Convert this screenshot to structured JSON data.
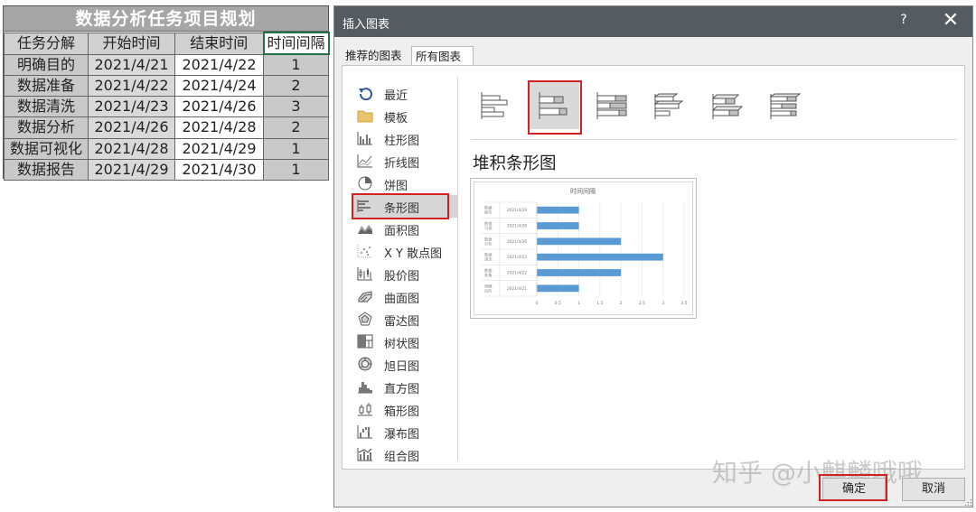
{
  "sheet": {
    "title": "数据分析任务项目规划",
    "headers": [
      "任务分解",
      "开始时间",
      "结束时间",
      "时间间隔"
    ],
    "rows": [
      [
        "明确目的",
        "2021/4/21",
        "2021/4/22",
        "1"
      ],
      [
        "数据准备",
        "2021/4/22",
        "2021/4/24",
        "2"
      ],
      [
        "数据清洗",
        "2021/4/23",
        "2021/4/26",
        "3"
      ],
      [
        "数据分析",
        "2021/4/26",
        "2021/4/28",
        "2"
      ],
      [
        "数据可视化",
        "2021/4/28",
        "2021/4/29",
        "1"
      ],
      [
        "数据报告",
        "2021/4/29",
        "2021/4/30",
        "1"
      ]
    ]
  },
  "dialog": {
    "title": "插入图表",
    "help": "?",
    "close": "✕",
    "tabs": [
      "推荐的图表",
      "所有图表"
    ],
    "chart_types": [
      {
        "label": "最近",
        "icon": "recent-icon"
      },
      {
        "label": "模板",
        "icon": "folder-icon"
      },
      {
        "label": "柱形图",
        "icon": "column-chart-icon"
      },
      {
        "label": "折线图",
        "icon": "line-chart-icon"
      },
      {
        "label": "饼图",
        "icon": "pie-chart-icon"
      },
      {
        "label": "条形图",
        "icon": "bar-chart-icon"
      },
      {
        "label": "面积图",
        "icon": "area-chart-icon"
      },
      {
        "label": "X Y 散点图",
        "icon": "scatter-chart-icon"
      },
      {
        "label": "股价图",
        "icon": "stock-chart-icon"
      },
      {
        "label": "曲面图",
        "icon": "surface-chart-icon"
      },
      {
        "label": "雷达图",
        "icon": "radar-chart-icon"
      },
      {
        "label": "树状图",
        "icon": "treemap-chart-icon"
      },
      {
        "label": "旭日图",
        "icon": "sunburst-chart-icon"
      },
      {
        "label": "直方图",
        "icon": "histogram-chart-icon"
      },
      {
        "label": "箱形图",
        "icon": "box-chart-icon"
      },
      {
        "label": "瀑布图",
        "icon": "waterfall-chart-icon"
      },
      {
        "label": "组合图",
        "icon": "combo-chart-icon"
      }
    ],
    "selected_type": "条形图",
    "subtype_name": "堆积条形图",
    "ok": "确定",
    "cancel": "取消",
    "accent": "#d42020"
  },
  "watermark": "知乎 @小麒麟哦哦",
  "chart_data": {
    "type": "bar",
    "orientation": "horizontal",
    "stacked": true,
    "title": "时间间隔",
    "categories": [
      [
        "明确",
        "目的",
        "2021/4/21"
      ],
      [
        "数据",
        "准备",
        "2021/4/22"
      ],
      [
        "数据",
        "清洗",
        "2021/4/23"
      ],
      [
        "数据",
        "分析",
        "2021/4/26"
      ],
      [
        "数据",
        "可视",
        "2021/4/28"
      ],
      [
        "数据",
        "报告",
        "2021/4/29"
      ]
    ],
    "values": [
      1,
      2,
      3,
      2,
      1,
      1
    ],
    "xlim": [
      0,
      3.5
    ],
    "x_ticks": [
      "0",
      "0.5",
      "1",
      "1.5",
      "2",
      "2.5",
      "3",
      "3.5"
    ],
    "grid": true,
    "legend": "none",
    "bar_color": "#5b9bd5"
  }
}
